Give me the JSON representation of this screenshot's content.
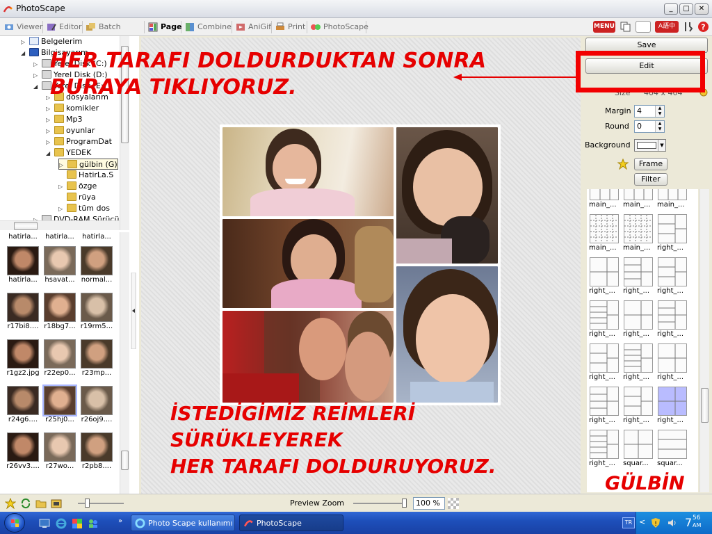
{
  "window": {
    "title": "PhotoScape",
    "btn_min": "_",
    "btn_max": "□",
    "btn_close": "✕"
  },
  "tabs": [
    {
      "label": "Viewer"
    },
    {
      "label": "Editor"
    },
    {
      "label": "Batch Editor"
    },
    {
      "label": "Page"
    },
    {
      "label": "Combine"
    },
    {
      "label": "AniGif"
    },
    {
      "label": "Print"
    },
    {
      "label": "PhotoScape"
    }
  ],
  "topbar": {
    "menu_label": "MENU",
    "lang_label": "A語中"
  },
  "tree": [
    {
      "label": "Belgelerim",
      "indent": 2,
      "exp": "▷"
    },
    {
      "label": "Bilgisayarım",
      "indent": 2,
      "exp": "◢"
    },
    {
      "label": "Yerel Disk (C:)",
      "indent": 3,
      "exp": "▷"
    },
    {
      "label": "Yerel Disk (D:)",
      "indent": 3,
      "exp": "▷"
    },
    {
      "label": "Yerel Disk (E:)",
      "indent": 3,
      "exp": "◢"
    },
    {
      "label": "dosyalarım",
      "indent": 4,
      "exp": "▷"
    },
    {
      "label": "komikler",
      "indent": 4,
      "exp": "▷"
    },
    {
      "label": "Mp3",
      "indent": 4,
      "exp": "▷"
    },
    {
      "label": "oyunlar",
      "indent": 4,
      "exp": "▷"
    },
    {
      "label": "ProgramDat",
      "indent": 4,
      "exp": "▷"
    },
    {
      "label": "YEDEK",
      "indent": 4,
      "exp": "◢"
    },
    {
      "label": "gülbin (G)",
      "indent": 5,
      "exp": "▷"
    },
    {
      "label": "HatirLa.S",
      "indent": 5,
      "exp": ""
    },
    {
      "label": "özge",
      "indent": 5,
      "exp": "▷"
    },
    {
      "label": "rüya",
      "indent": 5,
      "exp": ""
    },
    {
      "label": "tüm dos",
      "indent": 5,
      "exp": "▷"
    },
    {
      "label": "DVD-RAM Sürücü",
      "indent": 3,
      "exp": "▷"
    }
  ],
  "thumbnails": [
    "hatirla...",
    "hatirla...",
    "hatirla...",
    "hatirla...",
    "hsavat...",
    "normal...",
    "r17bi8....",
    "r18bg7...",
    "r19rm5...",
    "r1gz2.jpg",
    "r22ep0...",
    "r23mp...",
    "r24g6....",
    "r25hj0...",
    "r26oj9....",
    "r26vv3....",
    "r27wo...",
    "r2pb8...."
  ],
  "right_panel": {
    "save_label": "Save",
    "edit_label": "Edit",
    "size_label": "Size",
    "size_value": "404 x 404",
    "margin_label": "Margin",
    "margin_value": "4",
    "round_label": "Round",
    "round_value": "0",
    "background_label": "Background",
    "background_color": "#ffffff",
    "frame_label": "Frame",
    "filter_label": "Filter"
  },
  "templates": [
    "main_...",
    "main_...",
    "main_...",
    "main_...",
    "main_...",
    "right_...",
    "right_...",
    "right_...",
    "right_...",
    "right_...",
    "right_...",
    "right_...",
    "right_...",
    "right_...",
    "right_...",
    "right_...",
    "right_...",
    "right_...",
    "right_...",
    "squar...",
    "squar..."
  ],
  "bottombar": {
    "preview_zoom_label": "Preview Zoom",
    "zoom_value": "100 %"
  },
  "taskbar": {
    "items": [
      {
        "label": "Photo Scape kullanımı ..."
      },
      {
        "label": "PhotoScape"
      }
    ],
    "lang": "TR",
    "clock_hour": "7",
    "clock_min": "56",
    "clock_ampm": "AM"
  },
  "annotations": {
    "top_line1": "HER TARAFI DOLDURDUKTAN SONRA",
    "top_line2": "BURAYA TIKLIYORUZ.",
    "bottom_line1": "İSTEDİGİMİZ REİMLERİ",
    "bottom_line2": "SÜRÜKLEYEREK",
    "bottom_line3": "HER TARAFI DOLDURUYORUZ.",
    "signature": "GÜLBİN"
  },
  "colors": {
    "annotation_red": "#e60000",
    "accent_blue": "#1e4fba"
  }
}
